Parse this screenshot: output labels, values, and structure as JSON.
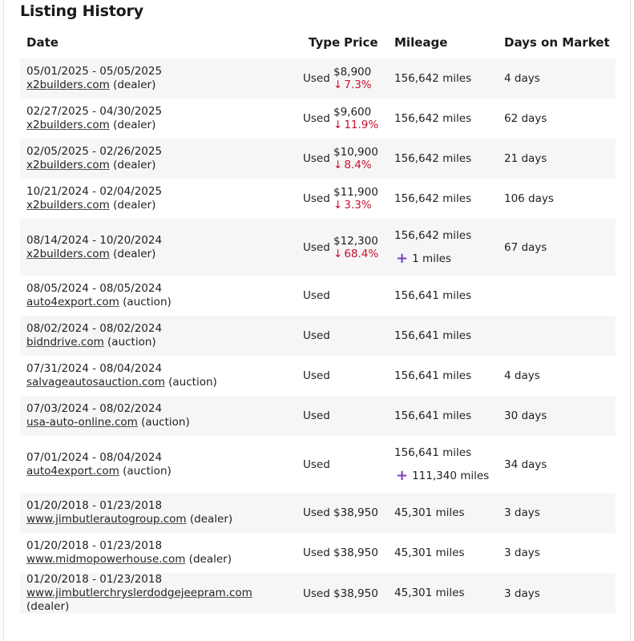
{
  "title": "Listing History",
  "columns": {
    "date": "Date",
    "type": "Type",
    "price": "Price",
    "mileage": "Mileage",
    "days": "Days on Market"
  },
  "colors": {
    "price_drop": "#c8102e",
    "mileage_add": "#7b3fbf",
    "row_stripe": "#f6f6f6"
  },
  "rows": [
    {
      "date": "05/01/2025 - 05/05/2025",
      "source": "x2builders.com",
      "source_type": "(dealer)",
      "type": "Used",
      "price": "$8,900",
      "price_change": "7.3%",
      "mileage": "156,642 miles",
      "mileage_added": "",
      "days": "4 days"
    },
    {
      "date": "02/27/2025 - 04/30/2025",
      "source": "x2builders.com",
      "source_type": "(dealer)",
      "type": "Used",
      "price": "$9,600",
      "price_change": "11.9%",
      "mileage": "156,642 miles",
      "mileage_added": "",
      "days": "62 days"
    },
    {
      "date": "02/05/2025 - 02/26/2025",
      "source": "x2builders.com",
      "source_type": "(dealer)",
      "type": "Used",
      "price": "$10,900",
      "price_change": "8.4%",
      "mileage": "156,642 miles",
      "mileage_added": "",
      "days": "21 days"
    },
    {
      "date": "10/21/2024 - 02/04/2025",
      "source": "x2builders.com",
      "source_type": "(dealer)",
      "type": "Used",
      "price": "$11,900",
      "price_change": "3.3%",
      "mileage": "156,642 miles",
      "mileage_added": "",
      "days": "106 days"
    },
    {
      "date": "08/14/2024 - 10/20/2024",
      "source": "x2builders.com",
      "source_type": "(dealer)",
      "type": "Used",
      "price": "$12,300",
      "price_change": "68.4%",
      "mileage": "156,642 miles",
      "mileage_added": "1 miles",
      "days": "67 days"
    },
    {
      "date": "08/05/2024 - 08/05/2024",
      "source": "auto4export.com",
      "source_type": "(auction)",
      "type": "Used",
      "price": "",
      "price_change": "",
      "mileage": "156,641 miles",
      "mileage_added": "",
      "days": ""
    },
    {
      "date": "08/02/2024 - 08/02/2024",
      "source": "bidndrive.com",
      "source_type": "(auction)",
      "type": "Used",
      "price": "",
      "price_change": "",
      "mileage": "156,641 miles",
      "mileage_added": "",
      "days": ""
    },
    {
      "date": "07/31/2024 - 08/04/2024",
      "source": "salvageautosauction.com",
      "source_type": "(auction)",
      "type": "Used",
      "price": "",
      "price_change": "",
      "mileage": "156,641 miles",
      "mileage_added": "",
      "days": "4 days"
    },
    {
      "date": "07/03/2024 - 08/02/2024",
      "source": "usa-auto-online.com",
      "source_type": "(auction)",
      "type": "Used",
      "price": "",
      "price_change": "",
      "mileage": "156,641 miles",
      "mileage_added": "",
      "days": "30 days"
    },
    {
      "date": "07/01/2024 - 08/04/2024",
      "source": "auto4export.com",
      "source_type": "(auction)",
      "type": "Used",
      "price": "",
      "price_change": "",
      "mileage": "156,641 miles",
      "mileage_added": "111,340 miles",
      "days": "34 days"
    },
    {
      "date": "01/20/2018 - 01/23/2018",
      "source": "www.jimbutlerautogroup.com",
      "source_type": "(dealer)",
      "type": "Used",
      "price": "$38,950",
      "price_change": "",
      "mileage": "45,301 miles",
      "mileage_added": "",
      "days": "3 days"
    },
    {
      "date": "01/20/2018 - 01/23/2018",
      "source": "www.midmopowerhouse.com",
      "source_type": "(dealer)",
      "type": "Used",
      "price": "$38,950",
      "price_change": "",
      "mileage": "45,301 miles",
      "mileage_added": "",
      "days": "3 days"
    },
    {
      "date": "01/20/2018 - 01/23/2018",
      "source": "www.jimbutlerchryslerdodgejeepram.com",
      "source_type": "(dealer)",
      "type": "Used",
      "price": "$38,950",
      "price_change": "",
      "mileage": "45,301 miles",
      "mileage_added": "",
      "days": "3 days"
    }
  ]
}
